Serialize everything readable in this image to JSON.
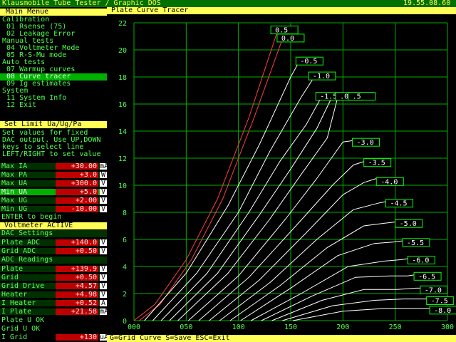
{
  "titlebar": {
    "app_title": "Klausmobile Tube Tester / Graphic DOS",
    "clock": "19.55.08.60"
  },
  "main_menu": {
    "header": "Main Menue",
    "lines": [
      {
        "text": "Calibration",
        "selected": false
      },
      {
        "text": " 01 Rsense (75)",
        "selected": false
      },
      {
        "text": " 02 Leakage Error",
        "selected": false
      },
      {
        "text": "Manual tests",
        "selected": false
      },
      {
        "text": " 04 Voltmeter Mode",
        "selected": false
      },
      {
        "text": " 05 R-S-Mu mode",
        "selected": false
      },
      {
        "text": "Auto tests",
        "selected": false
      },
      {
        "text": " 07 Warmup curves",
        "selected": false
      },
      {
        "text": " 08 Curve tracer",
        "selected": true
      },
      {
        "text": " 09 Ig estimates",
        "selected": false
      },
      {
        "text": "System",
        "selected": false
      },
      {
        "text": " 11 System Info",
        "selected": false
      },
      {
        "text": " 12 Exit",
        "selected": false
      }
    ]
  },
  "set_limit": {
    "header": "Set Limit Ua/Ug/Pa",
    "help": [
      "Set values for fixed",
      "DAC output. Use UP,DOWN",
      "keys to select line",
      "LEFT/RIGHT to set value"
    ],
    "rows": [
      {
        "label": "Max IA",
        "value": "+30.00",
        "unit": "mA",
        "highlight": false
      },
      {
        "label": "Max PA",
        "value": "+3.0",
        "unit": "W",
        "highlight": false
      },
      {
        "label": "Max UA",
        "value": "+300.0",
        "unit": "V",
        "highlight": false
      },
      {
        "label": "Min UA",
        "value": "+5.0",
        "unit": "V",
        "highlight": true
      },
      {
        "label": "Max UG",
        "value": "+2.00",
        "unit": "V",
        "highlight": false
      },
      {
        "label": "Min UG",
        "value": "-10.00",
        "unit": "V",
        "highlight": false
      }
    ],
    "enter_text": "ENTER to begin"
  },
  "voltmeter": {
    "header": "Voltmeter ACTIVE",
    "dac_header": "DAC Settings",
    "dac_rows": [
      {
        "label": "Plate ADC",
        "value": "+140.0",
        "unit": "V"
      },
      {
        "label": "Grid ADC",
        "value": "+0.50",
        "unit": "V"
      }
    ],
    "adc_header": "ADC Readings",
    "adc_rows": [
      {
        "label": "Plate",
        "value": "+139.9",
        "unit": "V"
      },
      {
        "label": "Grid",
        "value": "+0.50",
        "unit": "V"
      },
      {
        "label": "Grid Drive",
        "value": "+4.57",
        "unit": "V"
      },
      {
        "label": "Heater",
        "value": "+4.98",
        "unit": "V"
      },
      {
        "label": "I Heater",
        "value": "+0.52",
        "unit": "A"
      },
      {
        "label": "I Plate",
        "value": "+21.58",
        "unit": "mA"
      }
    ],
    "status_lines": [
      "Plate U OK",
      "Grid U OK"
    ],
    "igrid": {
      "label": "I Grid",
      "value": "+130",
      "unit": "uA"
    }
  },
  "plot": {
    "title": "Plate Curve Tracer"
  },
  "status_bar": {
    "text": "G=Grid Curve S=Save ESC=Exit"
  },
  "colors": {
    "accent": "#ffff55",
    "grid": "#00b000",
    "positive_curve": "#ff4040",
    "curve": "#ffffff",
    "label_box": "#00ff00"
  },
  "chart_data": {
    "type": "line",
    "xlim": [
      0,
      300
    ],
    "ylim": [
      0,
      22
    ],
    "x_ticks": [
      "000",
      "050",
      "100",
      "150",
      "200",
      "250",
      "300"
    ],
    "y_ticks": [
      "0",
      "2",
      "4",
      "6",
      "8",
      "10",
      "12",
      "14",
      "16",
      "18",
      "20",
      "22"
    ],
    "grid": true,
    "series": [
      {
        "name": "0.5",
        "points": [
          [
            0,
            0
          ],
          [
            20,
            1.2
          ],
          [
            50,
            4.5
          ],
          [
            80,
            9
          ],
          [
            110,
            15
          ],
          [
            137,
            21.3
          ]
        ],
        "positive": true
      },
      {
        "name": "0.0",
        "points": [
          [
            5,
            0
          ],
          [
            25,
            1.2
          ],
          [
            55,
            4.5
          ],
          [
            85,
            9
          ],
          [
            115,
            15
          ],
          [
            143,
            21
          ]
        ],
        "positive": true
      },
      {
        "name": "-0.5",
        "points": [
          [
            10,
            0
          ],
          [
            50,
            3.5
          ],
          [
            90,
            8.5
          ],
          [
            120,
            13
          ],
          [
            150,
            18
          ],
          [
            160,
            19.4
          ]
        ],
        "positive": false
      },
      {
        "name": "-1.0",
        "points": [
          [
            18,
            0
          ],
          [
            60,
            3.5
          ],
          [
            100,
            8
          ],
          [
            130,
            12.5
          ],
          [
            160,
            16.5
          ],
          [
            175,
            18.3
          ]
        ],
        "positive": false
      },
      {
        "name": "-1.5",
        "points": [
          [
            26,
            0
          ],
          [
            70,
            3.5
          ],
          [
            110,
            8
          ],
          [
            140,
            11.8
          ],
          [
            165,
            14.5
          ],
          [
            180,
            16.6
          ]
        ],
        "positive": false
      },
      {
        "name": "-2.0",
        "points": [
          [
            34,
            0
          ],
          [
            80,
            3.5
          ],
          [
            120,
            7.8
          ],
          [
            150,
            11.2
          ],
          [
            175,
            14.2
          ],
          [
            190,
            16.6
          ]
        ],
        "positive": false
      },
      {
        "name": "-2.5",
        "points": [
          [
            42,
            0
          ],
          [
            90,
            3.5
          ],
          [
            130,
            7.5
          ],
          [
            160,
            10.8
          ],
          [
            185,
            13.5
          ],
          [
            195,
            16.5
          ]
        ],
        "positive": false
      },
      {
        "name": "-3.0",
        "points": [
          [
            52,
            0
          ],
          [
            100,
            3.3
          ],
          [
            145,
            7.5
          ],
          [
            175,
            10.5
          ],
          [
            200,
            13.2
          ],
          [
            210,
            13.3
          ]
        ],
        "positive": false
      },
      {
        "name": "-3.5",
        "points": [
          [
            62,
            0
          ],
          [
            110,
            3.2
          ],
          [
            155,
            7
          ],
          [
            190,
            10
          ],
          [
            210,
            11.5
          ],
          [
            222,
            11.8
          ]
        ],
        "positive": false
      },
      {
        "name": "-4.0",
        "points": [
          [
            72,
            0
          ],
          [
            120,
            3
          ],
          [
            165,
            6.5
          ],
          [
            200,
            9.3
          ],
          [
            220,
            10.2
          ],
          [
            232,
            10.5
          ]
        ],
        "positive": false
      },
      {
        "name": "-4.5",
        "points": [
          [
            82,
            0
          ],
          [
            130,
            2.8
          ],
          [
            175,
            6
          ],
          [
            210,
            8.2
          ],
          [
            235,
            8.7
          ],
          [
            242,
            8.8
          ]
        ],
        "positive": false
      },
      {
        "name": "-5.0",
        "points": [
          [
            92,
            0
          ],
          [
            140,
            2.6
          ],
          [
            185,
            5.4
          ],
          [
            220,
            7
          ],
          [
            240,
            7.2
          ],
          [
            252,
            7.3
          ]
        ],
        "positive": false
      },
      {
        "name": "-5.5",
        "points": [
          [
            102,
            0
          ],
          [
            150,
            2.4
          ],
          [
            195,
            4.8
          ],
          [
            230,
            5.7
          ],
          [
            248,
            5.8
          ],
          [
            258,
            5.9
          ]
        ],
        "positive": false
      },
      {
        "name": "-6.0",
        "points": [
          [
            112,
            0
          ],
          [
            160,
            2
          ],
          [
            205,
            4
          ],
          [
            240,
            4.4
          ],
          [
            255,
            4.5
          ],
          [
            265,
            4.6
          ]
        ],
        "positive": false
      },
      {
        "name": "-6.5",
        "points": [
          [
            122,
            0
          ],
          [
            170,
            1.8
          ],
          [
            212,
            3.2
          ],
          [
            245,
            3.3
          ],
          [
            262,
            3.3
          ],
          [
            270,
            3.4
          ]
        ],
        "positive": false
      },
      {
        "name": "-7.0",
        "points": [
          [
            132,
            0
          ],
          [
            180,
            1.5
          ],
          [
            220,
            2.3
          ],
          [
            252,
            2.3
          ],
          [
            270,
            2.4
          ],
          [
            278,
            2.4
          ]
        ],
        "positive": false
      },
      {
        "name": "-7.5",
        "points": [
          [
            142,
            0
          ],
          [
            190,
            1.1
          ],
          [
            230,
            1.5
          ],
          [
            258,
            1.6
          ],
          [
            276,
            1.6
          ],
          [
            283,
            1.6
          ]
        ],
        "positive": false
      },
      {
        "name": "-8.0",
        "points": [
          [
            152,
            0
          ],
          [
            200,
            0.7
          ],
          [
            240,
            0.9
          ],
          [
            265,
            0.9
          ],
          [
            282,
            0.9
          ],
          [
            287,
            0.9
          ]
        ],
        "positive": false
      }
    ],
    "labels": [
      {
        "text": "0.5",
        "x": 131,
        "y": 21.5
      },
      {
        "text": "0.0",
        "x": 137,
        "y": 20.9
      },
      {
        "text": "-0.5",
        "x": 155,
        "y": 19.2
      },
      {
        "text": "-1.0",
        "x": 167,
        "y": 18.1
      },
      {
        "text": "-1.5",
        "x": 174,
        "y": 16.6
      },
      {
        "text": ".0",
        "x": 193,
        "y": 16.6
      },
      {
        "text": ".5",
        "x": 205,
        "y": 16.6
      },
      {
        "text": "-3.0",
        "x": 209,
        "y": 13.2
      },
      {
        "text": "-3.5",
        "x": 220,
        "y": 11.7
      },
      {
        "text": "-4.0",
        "x": 232,
        "y": 10.3
      },
      {
        "text": "-4.5",
        "x": 241,
        "y": 8.7
      },
      {
        "text": "-5.0",
        "x": 250,
        "y": 7.2
      },
      {
        "text": "-5.5",
        "x": 257,
        "y": 5.8
      },
      {
        "text": "-6.0",
        "x": 262,
        "y": 4.5
      },
      {
        "text": "-6.5",
        "x": 268,
        "y": 3.3
      },
      {
        "text": "-7.0",
        "x": 274,
        "y": 2.3
      },
      {
        "text": "-7.5",
        "x": 280,
        "y": 1.5
      },
      {
        "text": "-8.0",
        "x": 283,
        "y": 0.8
      }
    ]
  }
}
